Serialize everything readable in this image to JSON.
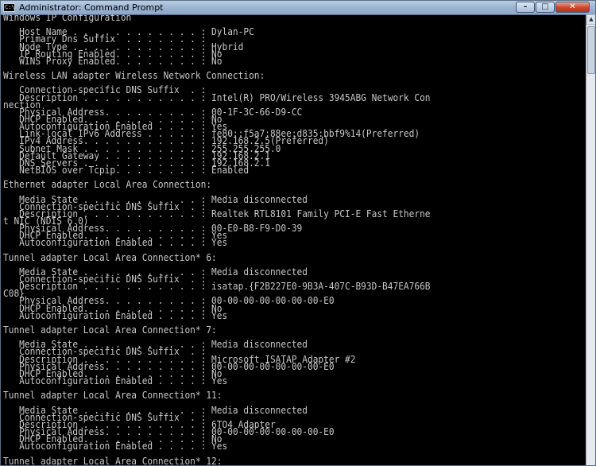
{
  "window": {
    "title": "Administrator: Command Prompt",
    "icon_text": "C:\\",
    "minimize_glyph": "–",
    "maximize_glyph": "□",
    "close_glyph": "✕"
  },
  "console": {
    "lines": [
      "Windows IP Configuration",
      "",
      "   Host Name . . . . . . . . . . . . : Dylan-PC",
      "   Primary Dns Suffix  . . . . . . . :",
      "   Node Type . . . . . . . . . . . . : Hybrid",
      "   IP Routing Enabled. . . . . . . . : No",
      "   WINS Proxy Enabled. . . . . . . . : No",
      "",
      "Wireless LAN adapter Wireless Network Connection:",
      "",
      "   Connection-specific DNS Suffix  . :",
      "   Description . . . . . . . . . . . : Intel(R) PRO/Wireless 3945ABG Network Con",
      "nection",
      "   Physical Address. . . . . . . . . : 00-1F-3C-66-D9-CC",
      "   DHCP Enabled. . . . . . . . . . . : No",
      "   Autoconfiguration Enabled . . . . : Yes",
      "   Link-local IPv6 Address . . . . . : fe80::f5a7:88ee:d835:bbf9%14(Preferred)",
      "   IPv4 Address. . . . . . . . . . . : 192.168.2.5(Preferred)",
      "   Subnet Mask . . . . . . . . . . . : 255.255.255.0",
      "   Default Gateway . . . . . . . . . : 192.168.2.1",
      "   DNS Servers . . . . . . . . . . . : 192.168.2.1",
      "   NetBIOS over Tcpip. . . . . . . . : Enabled",
      "",
      "Ethernet adapter Local Area Connection:",
      "",
      "   Media State . . . . . . . . . . . : Media disconnected",
      "   Connection-specific DNS Suffix  . :",
      "   Description . . . . . . . . . . . : Realtek RTL8101 Family PCI-E Fast Etherne",
      "t NIC (NDIS 6.0)",
      "   Physical Address. . . . . . . . . : 00-E0-B8-F9-D0-39",
      "   DHCP Enabled. . . . . . . . . . . : Yes",
      "   Autoconfiguration Enabled . . . . : Yes",
      "",
      "Tunnel adapter Local Area Connection* 6:",
      "",
      "   Media State . . . . . . . . . . . : Media disconnected",
      "   Connection-specific DNS Suffix  . :",
      "   Description . . . . . . . . . . . : isatap.{F2B227E0-9B3A-407C-B93D-B47EA766B",
      "C08}",
      "   Physical Address. . . . . . . . . : 00-00-00-00-00-00-00-E0",
      "   DHCP Enabled. . . . . . . . . . . : No",
      "   Autoconfiguration Enabled . . . . : Yes",
      "",
      "Tunnel adapter Local Area Connection* 7:",
      "",
      "   Media State . . . . . . . . . . . : Media disconnected",
      "   Connection-specific DNS Suffix  . :",
      "   Description . . . . . . . . . . . : Microsoft ISATAP Adapter #2",
      "   Physical Address. . . . . . . . . : 00-00-00-00-00-00-00-E0",
      "   DHCP Enabled. . . . . . . . . . . : No",
      "   Autoconfiguration Enabled . . . . : Yes",
      "",
      "Tunnel adapter Local Area Connection* 11:",
      "",
      "   Media State . . . . . . . . . . . : Media disconnected",
      "   Connection-specific DNS Suffix  . :",
      "   Description . . . . . . . . . . . : 6TO4 Adapter",
      "   Physical Address. . . . . . . . . : 00-00-00-00-00-00-00-E0",
      "   DHCP Enabled. . . . . . . . . . . : No",
      "   Autoconfiguration Enabled . . . . : Yes",
      "",
      "Tunnel adapter Local Area Connection* 12:"
    ]
  },
  "colors": {
    "console_background": "#000000",
    "console_text": "#c8c8c8",
    "close_button": "#c9472c"
  }
}
